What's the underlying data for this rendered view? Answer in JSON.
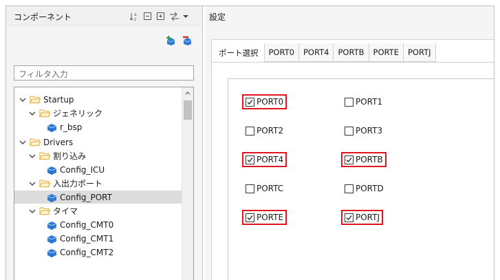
{
  "components_panel": {
    "title": "コンポーネント",
    "header_icons": [
      "sort-az-icon",
      "collapse-all-icon",
      "expand-all-icon",
      "link-icon",
      "dropdown-arrow-icon"
    ],
    "toolbar_icons": [
      "add-component-icon",
      "remove-component-icon"
    ],
    "filter_placeholder": "フィルタ入力",
    "tree": [
      {
        "label": "Startup",
        "icon": "folder-icon",
        "expander": "expanded"
      },
      {
        "label": "ジェネリック",
        "icon": "folder-icon",
        "expander": "expanded"
      },
      {
        "label": "r_bsp",
        "icon": "component-icon",
        "expander": "none"
      },
      {
        "label": "Drivers",
        "icon": "folder-icon",
        "expander": "expanded"
      },
      {
        "label": "割り込み",
        "icon": "folder-icon",
        "expander": "expanded"
      },
      {
        "label": "Config_ICU",
        "icon": "component-icon",
        "expander": "none"
      },
      {
        "label": "入出力ポート",
        "icon": "folder-icon",
        "expander": "expanded"
      },
      {
        "label": "Config_PORT",
        "icon": "component-icon",
        "expander": "none",
        "selected": true
      },
      {
        "label": "タイマ",
        "icon": "folder-icon",
        "expander": "expanded"
      },
      {
        "label": "Config_CMT0",
        "icon": "component-icon",
        "expander": "none"
      },
      {
        "label": "Config_CMT1",
        "icon": "component-icon",
        "expander": "none"
      },
      {
        "label": "Config_CMT2",
        "icon": "component-icon",
        "expander": "none"
      }
    ]
  },
  "settings_panel": {
    "title": "設定",
    "tabs": [
      {
        "label": "ポート選択",
        "active": true
      },
      {
        "label": "PORT0"
      },
      {
        "label": "PORT4"
      },
      {
        "label": "PORTB"
      },
      {
        "label": "PORTE"
      },
      {
        "label": "PORTJ"
      }
    ],
    "ports": [
      {
        "label": "PORT0",
        "checked": true,
        "highlighted": true
      },
      {
        "label": "PORT1",
        "checked": false,
        "highlighted": false
      },
      {
        "label": "PORT2",
        "checked": false,
        "highlighted": false
      },
      {
        "label": "PORT3",
        "checked": false,
        "highlighted": false
      },
      {
        "label": "PORT4",
        "checked": true,
        "highlighted": true
      },
      {
        "label": "PORTB",
        "checked": true,
        "highlighted": true
      },
      {
        "label": "PORTC",
        "checked": false,
        "highlighted": false
      },
      {
        "label": "PORTD",
        "checked": false,
        "highlighted": false
      },
      {
        "label": "PORTE",
        "checked": true,
        "highlighted": true
      },
      {
        "label": "PORTJ",
        "checked": true,
        "highlighted": true
      }
    ]
  },
  "colors": {
    "highlight": "#e0141e",
    "folder": "#e8b84a",
    "component": "#2f7ad6"
  }
}
